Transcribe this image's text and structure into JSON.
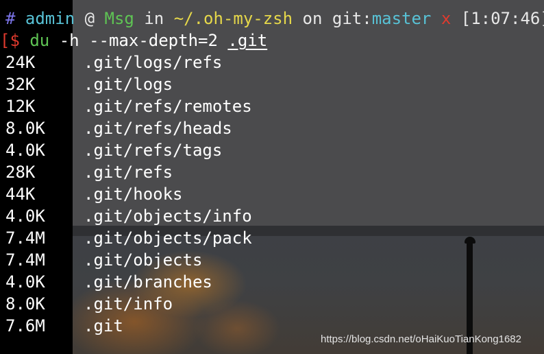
{
  "prompt": {
    "hash": "#",
    "user": "admin",
    "at": "@",
    "host": "Msg",
    "in_word": "in",
    "path": "~/.oh-my-zsh",
    "on_word": "on",
    "git_label": "git:",
    "branch": "master",
    "dirty_mark": "x",
    "time": "[1:07:46]"
  },
  "command": {
    "bracket": "[",
    "dollar": "$",
    "name": "du",
    "flag1": "-h",
    "flag2": "--max-depth=2",
    "target": ".git"
  },
  "output": [
    {
      "size": "24K",
      "path": ".git/logs/refs"
    },
    {
      "size": "32K",
      "path": ".git/logs"
    },
    {
      "size": "12K",
      "path": ".git/refs/remotes"
    },
    {
      "size": "8.0K",
      "path": ".git/refs/heads"
    },
    {
      "size": "4.0K",
      "path": ".git/refs/tags"
    },
    {
      "size": "28K",
      "path": ".git/refs"
    },
    {
      "size": "44K",
      "path": ".git/hooks"
    },
    {
      "size": "4.0K",
      "path": ".git/objects/info"
    },
    {
      "size": "7.4M",
      "path": ".git/objects/pack"
    },
    {
      "size": "7.4M",
      "path": ".git/objects"
    },
    {
      "size": "4.0K",
      "path": ".git/branches"
    },
    {
      "size": "8.0K",
      "path": ".git/info"
    },
    {
      "size": "7.6M",
      "path": ".git"
    }
  ],
  "watermark": "https://blog.csdn.net/oHaiKuoTianKong1682",
  "colors": {
    "terminal_bg": "#4b4b4d",
    "prompt_user": "#58c2d6",
    "prompt_host": "#5fc454",
    "prompt_path": "#e6d84a",
    "prompt_dirty": "#e03a2e"
  }
}
